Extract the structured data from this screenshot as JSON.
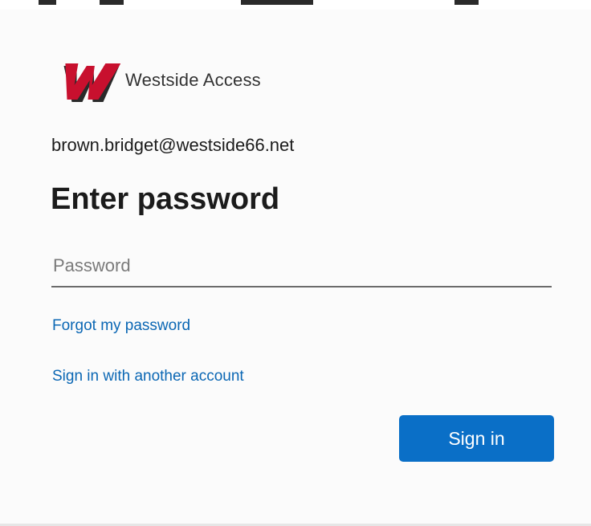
{
  "brand": {
    "name": "Westside Access",
    "logo_letter": "W",
    "logo_color": "#c8102e"
  },
  "account": {
    "email": "brown.bridget@westside66.net"
  },
  "form": {
    "heading": "Enter password",
    "password_placeholder": "Password",
    "password_value": ""
  },
  "links": {
    "forgot_password": "Forgot my password",
    "another_account": "Sign in with another account"
  },
  "actions": {
    "sign_in_label": "Sign in"
  },
  "colors": {
    "link": "#0b67b4",
    "primary_button": "#0a6fc7",
    "text": "#1b1b1b"
  }
}
